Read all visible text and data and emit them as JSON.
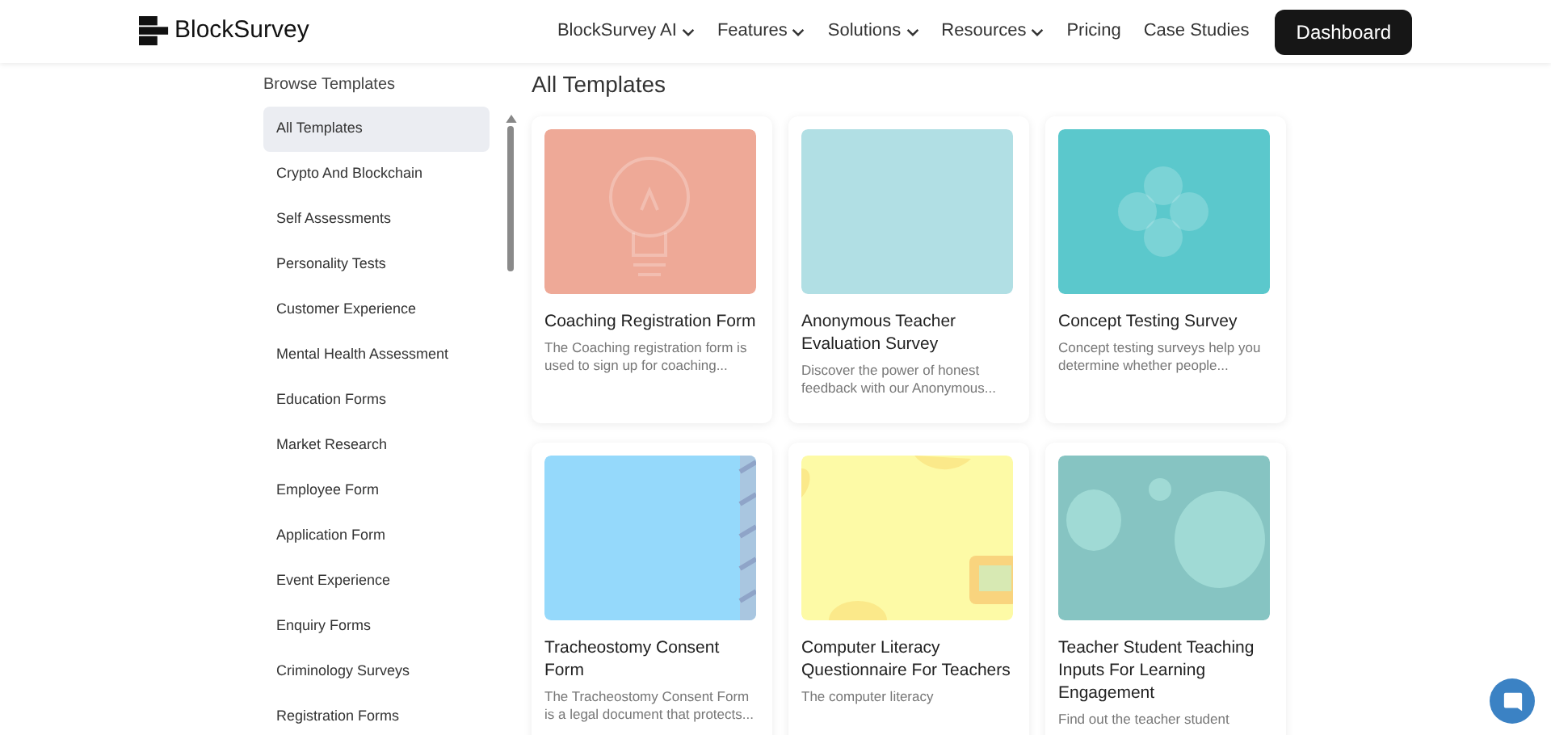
{
  "header": {
    "logo": "BlockSurvey",
    "nav": [
      {
        "label": "BlockSurvey AI",
        "dropdown": true
      },
      {
        "label": "Features",
        "dropdown": true
      },
      {
        "label": "Solutions",
        "dropdown": true
      },
      {
        "label": "Resources",
        "dropdown": true
      },
      {
        "label": "Pricing",
        "dropdown": false
      },
      {
        "label": "Case Studies",
        "dropdown": false
      }
    ],
    "cta": "Dashboard"
  },
  "sidebar": {
    "title": "Browse Templates",
    "items": [
      {
        "label": "All Templates",
        "selected": true
      },
      {
        "label": "Crypto And Blockchain",
        "selected": false
      },
      {
        "label": "Self Assessments",
        "selected": false
      },
      {
        "label": "Personality Tests",
        "selected": false
      },
      {
        "label": "Customer Experience",
        "selected": false
      },
      {
        "label": "Mental Health Assessment",
        "selected": false
      },
      {
        "label": "Education Forms",
        "selected": false
      },
      {
        "label": "Market Research",
        "selected": false
      },
      {
        "label": "Employee Form",
        "selected": false
      },
      {
        "label": "Application Form",
        "selected": false
      },
      {
        "label": "Event Experience",
        "selected": false
      },
      {
        "label": "Enquiry Forms",
        "selected": false
      },
      {
        "label": "Criminology Surveys",
        "selected": false
      },
      {
        "label": "Registration Forms",
        "selected": false
      }
    ]
  },
  "main": {
    "title": "All Templates",
    "cards": [
      {
        "title": "Coaching Registration Form",
        "description": "The Coaching registration form is used to sign up for coaching...",
        "kind": "bulb",
        "color": "#eea997"
      },
      {
        "title": "Anonymous Teacher Evaluation Survey",
        "description": "Discover the power of honest feedback with our Anonymous...",
        "kind": "plain",
        "color": "#b1dfe4"
      },
      {
        "title": "Concept Testing Survey",
        "description": "Concept testing surveys help you determine whether people...",
        "kind": "flower",
        "color": "#5bc8cc"
      },
      {
        "title": "Tracheostomy Consent Form",
        "description": "The Tracheostomy Consent Form is a legal document that protects...",
        "kind": "stripes",
        "color": "#95d9fb"
      },
      {
        "title": "Computer Literacy Questionnaire For Teachers",
        "description": "The computer literacy",
        "kind": "screen",
        "color": "#fdfaa6"
      },
      {
        "title": "Teacher Student Teaching Inputs For Learning Engagement",
        "description": "Find out the teacher student",
        "kind": "blobs",
        "color": "#86c4c2"
      }
    ]
  }
}
